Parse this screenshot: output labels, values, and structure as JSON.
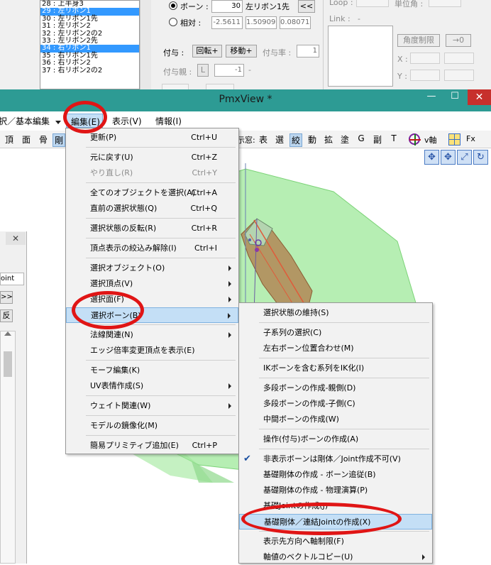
{
  "bone_list": [
    {
      "label": "28 : 上半身3",
      "selected": false
    },
    {
      "label": "29 : 左リボン1",
      "selected": true
    },
    {
      "label": "30 : 左リボン1先",
      "selected": false
    },
    {
      "label": "31 : 左リボン2",
      "selected": false
    },
    {
      "label": "32 : 左リボン2の2",
      "selected": false
    },
    {
      "label": "33 : 左リボン2先",
      "selected": false
    },
    {
      "label": "34 : 右リボン1",
      "selected": true
    },
    {
      "label": "35 : 右リボン1先",
      "selected": false
    },
    {
      "label": "36 : 右リボン2",
      "selected": false
    },
    {
      "label": "37 : 右リボン2の2",
      "selected": false
    }
  ],
  "bone_props": {
    "bone_radio_label": "ボーン :",
    "bone_value": "30",
    "bone_name": "左リボン1先",
    "nav_button": "<<",
    "relative_radio_label": "相対 :",
    "rel_x": "-2.5611",
    "rel_y": "1.50909",
    "rel_z": "0.08071",
    "grant_label": "付与 :",
    "rotate_button": "回転+",
    "move_button": "移動+",
    "grant_rate_label": "付与率 :",
    "grant_rate_value": "1",
    "grant_parent_label": "付与親 :",
    "grant_parent_btn": "L",
    "grant_parent_value": "-1",
    "grant_parent_dash": "-"
  },
  "ik_panel": {
    "loop_label": "Loop :",
    "unit_angle_label": "単位角 :",
    "link_label": "Link :",
    "link_dash": "-",
    "angle_limit_button": "角度制限",
    "arrow_zero_button": "→0",
    "x_label": "X :",
    "y_label": "Y :"
  },
  "window": {
    "title": "PmxView *",
    "minimize": "—",
    "maximize": "☐",
    "close": "✕"
  },
  "menubar": [
    "選択／基本編集",
    "編集(E)",
    "表示(V)",
    "情報(I)"
  ],
  "toolbar_left": [
    "頂",
    "面",
    "骨",
    "剛"
  ],
  "toolbar_right_label": "示窓:",
  "toolbar_right": [
    "表",
    "選",
    "絞",
    "動",
    "拡",
    "塗",
    "G",
    "副",
    "T"
  ],
  "toolbar_extra": {
    "vaxis": "v軸",
    "fx": "Fx"
  },
  "side_panel": {
    "close": "✕",
    "joint_tab": "oint",
    "btn_forward": ">>",
    "btn_reverse": "反"
  },
  "edit_menu": [
    {
      "label": "更新(P)",
      "shortcut": "Ctrl+U"
    },
    {
      "sep": true
    },
    {
      "label": "元に戻す(U)",
      "shortcut": "Ctrl+Z"
    },
    {
      "label": "やり直し(R)",
      "shortcut": "Ctrl+Y",
      "disabled": true
    },
    {
      "sep": true
    },
    {
      "label": "全てのオブジェクトを選択(A)",
      "shortcut": "Ctrl+A"
    },
    {
      "label": "直前の選択状態(Q)",
      "shortcut": "Ctrl+Q"
    },
    {
      "sep": true
    },
    {
      "label": "選択状態の反転(R)",
      "shortcut": "Ctrl+R"
    },
    {
      "sep": true
    },
    {
      "label": "頂点表示の絞込み解除(I)",
      "shortcut": "Ctrl+I"
    },
    {
      "sep": true
    },
    {
      "label": "選択オブジェクト(O)",
      "submenu": true
    },
    {
      "label": "選択頂点(V)",
      "submenu": true
    },
    {
      "label": "選択面(F)",
      "submenu": true
    },
    {
      "label": "選択ボーン(B)",
      "submenu": true,
      "highlighted": true
    },
    {
      "sep": true
    },
    {
      "label": "法線関連(N)",
      "submenu": true
    },
    {
      "label": "エッジ倍率変更頂点を表示(E)"
    },
    {
      "sep": true
    },
    {
      "label": "モーフ編集(K)"
    },
    {
      "label": "UV表情作成(S)",
      "submenu": true
    },
    {
      "sep": true
    },
    {
      "label": "ウェイト関連(W)",
      "submenu": true
    },
    {
      "sep": true
    },
    {
      "label": "モデルの鏡像化(M)"
    },
    {
      "sep": true
    },
    {
      "label": "簡易プリミティブ追加(E)",
      "shortcut": "Ctrl+P"
    }
  ],
  "bone_submenu": [
    {
      "label": "選択状態の維持(S)"
    },
    {
      "sep": true
    },
    {
      "label": "子系列の選択(C)"
    },
    {
      "label": "左右ボーン位置合わせ(M)"
    },
    {
      "sep": true
    },
    {
      "label": "IKボーンを含む系列をIK化(I)"
    },
    {
      "sep": true
    },
    {
      "label": "多段ボーンの作成-親側(D)"
    },
    {
      "label": "多段ボーンの作成-子側(C)"
    },
    {
      "label": "中間ボーンの作成(W)"
    },
    {
      "sep": true
    },
    {
      "label": "操作(付与)ボーンの作成(A)"
    },
    {
      "sep": true
    },
    {
      "label": "非表示ボーンは剛体／Joint作成不可(V)",
      "checked": true
    },
    {
      "label": "基礎剛体の作成 - ボーン追従(B)"
    },
    {
      "label": "基礎剛体の作成 - 物理演算(P)"
    },
    {
      "label": "基礎Jointの作成(J)"
    },
    {
      "label": "基礎剛体／連結Jointの作成(X)",
      "highlighted": true
    },
    {
      "sep": true
    },
    {
      "label": "表示先方向へ軸制限(F)"
    },
    {
      "label": "軸値のベクトルコピー(U)",
      "submenu": true
    }
  ],
  "colors": {
    "titlebar": "#2d9b94",
    "close": "#c7302c",
    "selection": "#3399ff",
    "menu_highlight": "#c4dff6",
    "annotation": "#e01515",
    "mesh_green": "#9ee89a"
  }
}
